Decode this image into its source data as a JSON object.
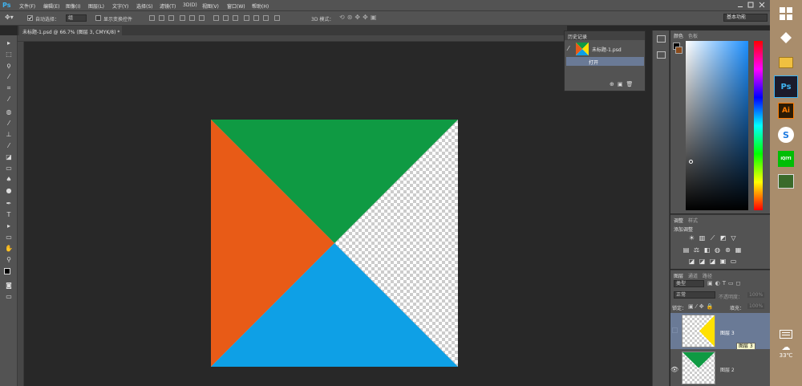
{
  "app": {
    "logo": "Ps",
    "menu": [
      "文件(F)",
      "编辑(E)",
      "图像(I)",
      "图层(L)",
      "文字(Y)",
      "选择(S)",
      "滤镜(T)",
      "3D(D)",
      "视图(V)",
      "窗口(W)",
      "帮助(H)"
    ]
  },
  "options": {
    "auto_select_label": "自动选择：",
    "auto_select_value": "组",
    "show_transform_label": "显示变换控件",
    "mode_3d_label": "3D 模式：",
    "workspace": "基本功能"
  },
  "document": {
    "tab_title": "未标题-1.psd @ 66.7% (图层 3, CMYK/8) *",
    "colors": {
      "green": "#0f9a43",
      "orange": "#e85b17",
      "blue": "#0ea0e6"
    }
  },
  "history": {
    "title": "历史记录",
    "snapshot_name": "未标题-1.psd",
    "step": "打开"
  },
  "color_panel": {
    "tabs": [
      "颜色",
      "色板"
    ]
  },
  "adjustments": {
    "tabs": [
      "调整",
      "样式"
    ],
    "add_label": "添加调整"
  },
  "layers": {
    "tabs": [
      "图层",
      "通道",
      "路径"
    ],
    "filter": "类型",
    "blend_mode": "正常",
    "opacity_label": "不透明度：",
    "opacity_value": "100%",
    "lock_label": "锁定：",
    "fill_label": "填充：",
    "fill_value": "100%",
    "items": [
      {
        "name": "图层 3",
        "tooltip": "图层 3"
      },
      {
        "name": "图层 2"
      }
    ]
  },
  "taskbar": {
    "apps": [
      "Ps",
      "Ai",
      "S",
      "iQIYI"
    ],
    "temperature": "33℃"
  }
}
